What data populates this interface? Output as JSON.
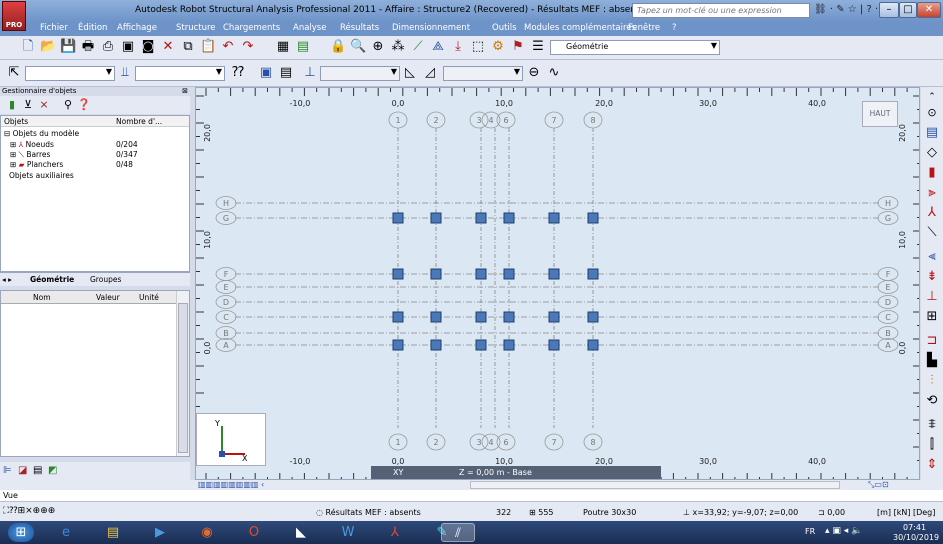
{
  "window": {
    "title": "Autodesk Robot Structural Analysis Professional 2011 - Affaire : Structure2 (Recovered) - Résultats MEF : absents",
    "search_placeholder": "Tapez un mot-clé ou une expression",
    "logo_label": "PRO"
  },
  "menu": [
    "Fichier",
    "Édition",
    "Affichage",
    "Structure",
    "Chargements",
    "Analyse",
    "Résultats",
    "Dimensionnement",
    "Outils",
    "Modules complémentaires",
    "Fenêtre",
    "?"
  ],
  "toolbar": {
    "layout_combo": "Géométrie"
  },
  "object_manager": {
    "title": "Gestionnaire d'objets",
    "col_objects": "Objets",
    "col_count": "Nombre d'...",
    "root": "Objets du modèle",
    "items": [
      {
        "label": "Noeuds",
        "count": "0/204"
      },
      {
        "label": "Barres",
        "count": "0/347"
      },
      {
        "label": "Planchers",
        "count": "0/48"
      }
    ],
    "aux": "Objets auxiliaires",
    "tabs": [
      "Géométrie",
      "Groupes"
    ]
  },
  "properties": {
    "col_name": "Nom",
    "col_value": "Valeur",
    "col_unit": "Unité"
  },
  "view": {
    "top_ticks": [
      "-10,0",
      "0,0",
      "10,0",
      "20,0",
      "30,0",
      "40,0"
    ],
    "bottom_ticks": [
      "-10,0",
      "0,0",
      "10,0",
      "20,0",
      "30,0",
      "40,0"
    ],
    "left_ticks": [
      "20,0",
      "10,0",
      "0,0"
    ],
    "right_ticks": [
      "20,0",
      "10,0",
      "0,0"
    ],
    "grid_x": [
      "1",
      "2",
      "3",
      "4",
      "5",
      "6",
      "7",
      "8"
    ],
    "grid_y": [
      "H",
      "G",
      "F",
      "E",
      "D",
      "C",
      "B",
      "A"
    ],
    "view_cube_label": "HAUT",
    "plane_label": "XY",
    "level_label": "Z = 0,00 m - Base",
    "axis_x": "X",
    "axis_y": "Y"
  },
  "statusbar": {
    "vue": "Vue",
    "results": "Résultats MEF : absents",
    "nodes": "322",
    "bars": "555",
    "section": "Poutre 30x30",
    "coords": "x=33,92; y=-9,07; z=0,00",
    "zero": "0,00",
    "units": "[m] [kN] [Deg]"
  },
  "taskbar": {
    "lang": "FR",
    "time": "07:41",
    "date": "30/10/2019"
  }
}
